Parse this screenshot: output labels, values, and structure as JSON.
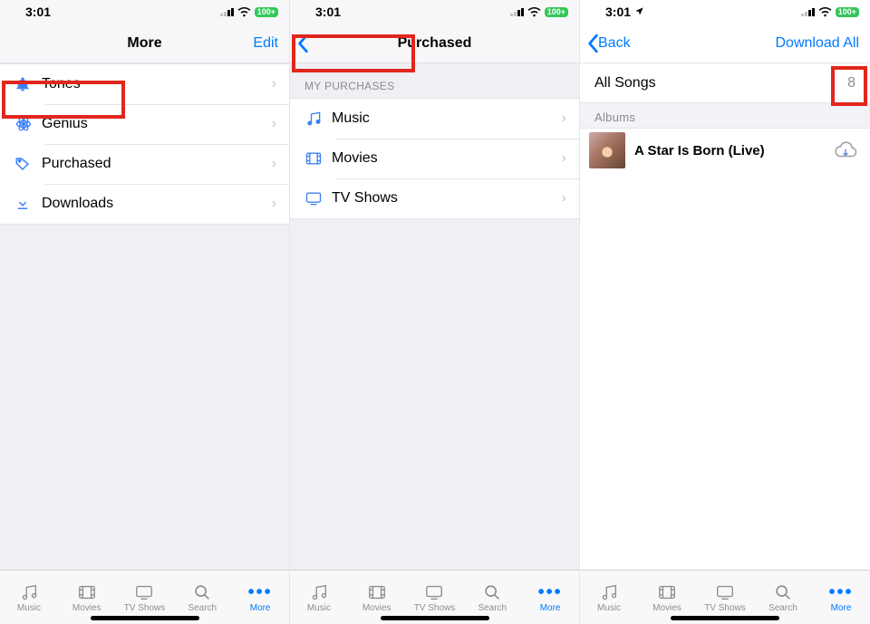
{
  "status": {
    "time": "3:01",
    "battery_label": "100+"
  },
  "tabs": {
    "music": "Music",
    "movies": "Movies",
    "tvshows": "TV Shows",
    "search": "Search",
    "more": "More"
  },
  "screen1": {
    "nav_title": "More",
    "nav_right": "Edit",
    "rows": {
      "tones": "Tones",
      "genius": "Genius",
      "purchased": "Purchased",
      "downloads": "Downloads"
    }
  },
  "screen2": {
    "nav_title": "Purchased",
    "section_header": "MY PURCHASES",
    "rows": {
      "music": "Music",
      "movies": "Movies",
      "tvshows": "TV Shows"
    }
  },
  "screen3": {
    "nav_back": "Back",
    "nav_right": "Download All",
    "all_songs_label": "All Songs",
    "all_songs_count": "8",
    "albums_header": "Albums",
    "album_title": "A Star Is Born (Live)"
  }
}
